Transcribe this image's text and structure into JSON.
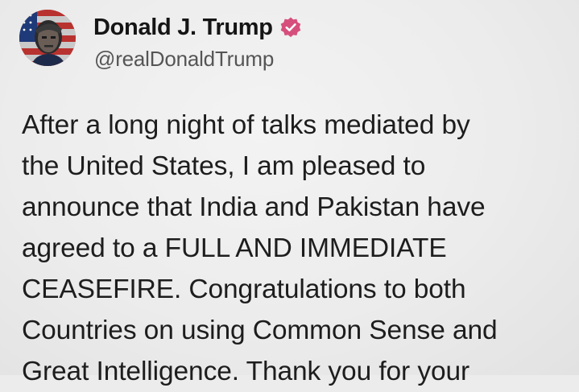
{
  "post": {
    "author_name": "Donald J. Trump",
    "author_handle": "@realDonaldTrump",
    "avatar_icon": "profile-portrait-flag",
    "verified_icon": "verified-badge-icon",
    "verified_color": "#d64f7c",
    "text_lines": [
      "After a long night of talks mediated by",
      "the United States, I am pleased to",
      "announce that India and Pakistan have",
      "agreed to a FULL AND IMMEDIATE",
      "CEASEFIRE. Congratulations to both",
      "Countries on using Common Sense and",
      "Great Intelligence. Thank you for your"
    ]
  }
}
